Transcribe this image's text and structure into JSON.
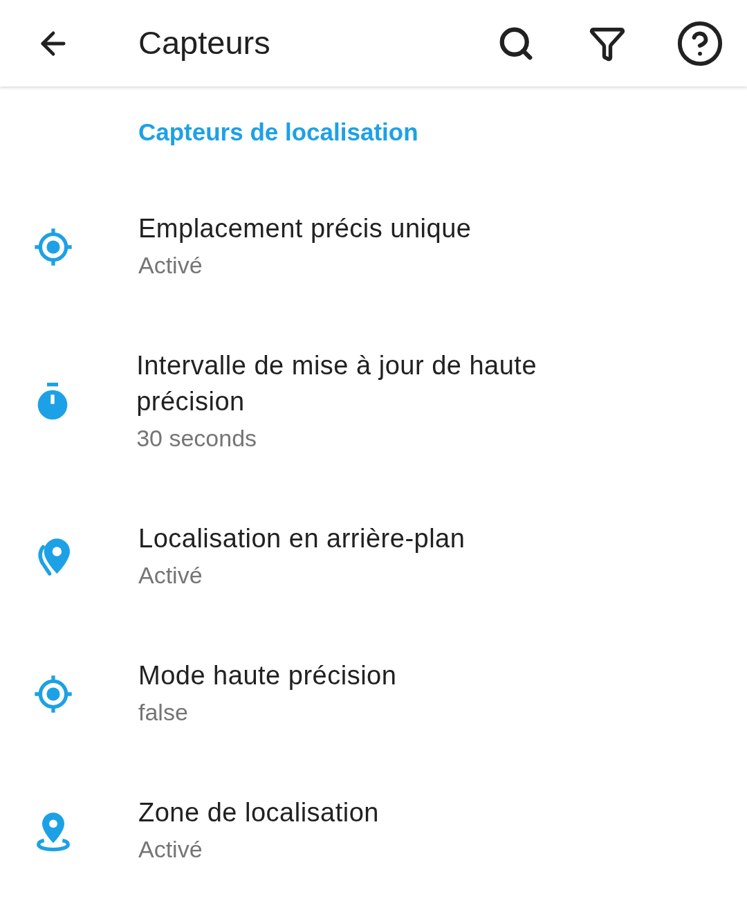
{
  "app_bar": {
    "title": "Capteurs"
  },
  "section": {
    "title": "Capteurs de localisation"
  },
  "items": [
    {
      "kind": "target",
      "title": "Emplacement précis unique",
      "subtitle": "Activé"
    },
    {
      "kind": "timer",
      "title": "Intervalle de mise à jour de haute précision",
      "subtitle": "30 seconds"
    },
    {
      "kind": "background",
      "title": "Localisation en arrière-plan",
      "subtitle": "Activé"
    },
    {
      "kind": "target",
      "title": "Mode haute précision",
      "subtitle": "false"
    },
    {
      "kind": "zone",
      "title": "Zone de localisation",
      "subtitle": "Activé"
    }
  ]
}
